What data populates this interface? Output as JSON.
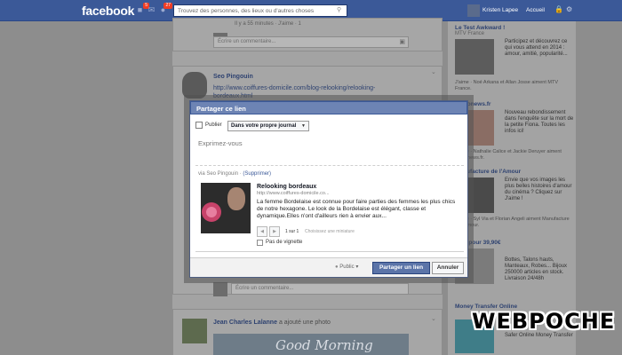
{
  "topbar": {
    "logo": "facebook",
    "friend_requests_count": "5",
    "notifications_count": "27",
    "search_placeholder": "Trouvez des personnes, des lieux ou d'autres choses",
    "profile_name": "Kristen Lapee",
    "home_label": "Accueil"
  },
  "feed": {
    "top_post": {
      "meta": "Il y a 55 minutes · J'aime · 1",
      "comment_placeholder": "Écrire un commentaire..."
    },
    "post_seo": {
      "author": "Seo Pingouin",
      "link_line1": "http://www.coiffures-domicile.com/blog-relooking/relooking-",
      "link_line2": "bordeaux.html"
    },
    "post_mid": {
      "comment_placeholder": "Écrire un commentaire..."
    },
    "post_jean": {
      "author": "Jean Charles Lalanne",
      "action": "a ajouté une photo",
      "image_text": "Good Morning"
    }
  },
  "ads": [
    {
      "title": "Le Test Awkward !",
      "sub": "MTV France",
      "text": "Participez et découvrez ce qui vous attend en 2014 : amour, amitié, popularité...",
      "like": "J'aime · Noé Arkana et Allan Josse aiment MTV France."
    },
    {
      "title": "Metronews.fr",
      "text": "Nouveau rebondissement dans l'enquête sur la mort de la petite Fiona. Toutes les infos ici!",
      "like": "J'aime · Nathalie Calice et Jackie Deruyer aiment Metronews.fr."
    },
    {
      "title": "Manufacture de l'Amour",
      "text": "Envie que vos images les plus belles histoires d'amour du cinéma ? Cliquez sur J'aime !",
      "like": "J'aime · Syl Via et Florian Angeli aiment Manufacture de l'Amour."
    },
    {
      "title": "Tout pour 39,90€",
      "text": "Bottes, Talons hauts, Manteaux, Robes... Bijoux 250000 articles en stock. Livraison 24/48h",
      "like": ""
    },
    {
      "title": "Money Transfer Online",
      "text": "Safer Online Money Transfer",
      "like": ""
    }
  ],
  "dialog": {
    "title": "Partager ce lien",
    "publier": "Publier",
    "target_select": "Dans votre propre journal",
    "message_placeholder": "Exprimez-vous",
    "via_text": "via Seo Pingouin ·",
    "via_remove": "(Supprimer)",
    "link_title": "Relooking bordeaux",
    "link_url": "http://www.coiffures-domicile.co...",
    "link_description": "La femme Bordelaise est connue pour faire parties des femmes les plus chics de notre hexagone. Le look de la Bordelaise est élégant, classe et dynamique.Elles n'ont d'ailleurs rien à envier aux...",
    "page_count": "1 sur 1",
    "choose_thumb": "Choisissez une miniature",
    "no_thumb": "Pas de vignette",
    "audience": "Public",
    "share_button": "Partager un lien",
    "cancel_button": "Annuler"
  },
  "watermark": {
    "text": "WEBPOCHE"
  }
}
